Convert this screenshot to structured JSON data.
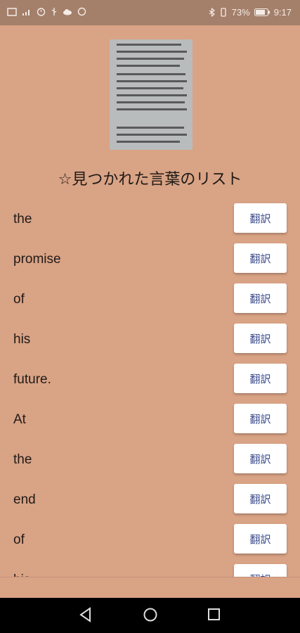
{
  "status_bar": {
    "battery_percent": "73%",
    "time": "9:17"
  },
  "title": "☆見つかれた言葉のリスト",
  "translate_label": "翻訳",
  "words": [
    "the",
    "promise",
    "of",
    "his",
    "future.",
    "At",
    "the",
    "end",
    "of",
    "his"
  ],
  "colors": {
    "background": "#d9a385",
    "status_bar": "#a47f6a",
    "button_text": "#3a4a8c"
  }
}
